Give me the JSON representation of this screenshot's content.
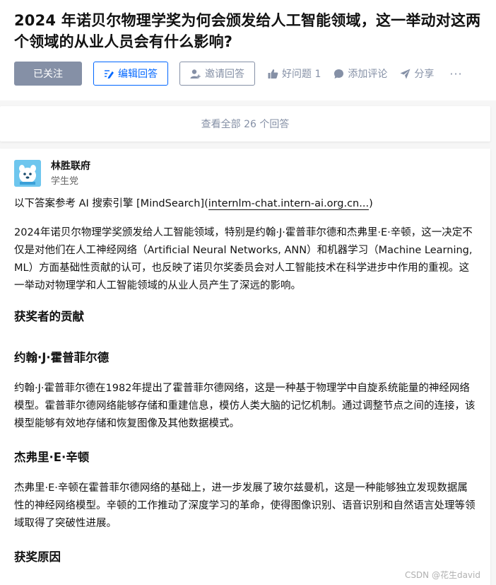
{
  "question": {
    "title": "2024 年诺贝尔物理学奖为何会颁发给人工智能领域，这一举动对这两个领域的从业人员会有什么影响?"
  },
  "actions": {
    "follow_label": "已关注",
    "edit_label": "编辑回答",
    "invite_label": "邀请回答",
    "good_question_label": "好问题 1",
    "comment_label": "添加评论",
    "share_label": "分享",
    "more_label": "···"
  },
  "view_all": {
    "label": "查看全部 26 个回答"
  },
  "answer": {
    "author_name": "林胜联府",
    "author_badge": "学生党",
    "source_prefix": "以下答案参考 AI 搜索引擎 [MindSearch](",
    "source_link": "internlm-chat.intern-ai.org.cn...",
    "source_suffix": ")",
    "intro": "2024年诺贝尔物理学奖颁发给人工智能领域，特别是约翰·J·霍普菲尔德和杰弗里·E·辛顿，这一决定不仅是对他们在人工神经网络（Artificial Neural Networks, ANN）和机器学习（Machine Learning, ML）方面基础性贡献的认可，也反映了诺贝尔奖委员会对人工智能技术在科学进步中作用的重视。这一举动对物理学和人工智能领域的从业人员产生了深远的影响。",
    "section1_heading": "获奖者的贡献",
    "hopfield_heading": "约翰·J·霍普菲尔德",
    "hopfield_text": "约翰·J·霍普菲尔德在1982年提出了霍普菲尔德网络，这是一种基于物理学中自旋系统能量的神经网络模型。霍普菲尔德网络能够存储和重建信息，模仿人类大脑的记忆机制。通过调整节点之间的连接，该模型能够有效地存储和恢复图像及其他数据模式。",
    "hinton_heading": "杰弗里·E·辛顿",
    "hinton_text": "杰弗里·E·辛顿在霍普菲尔德网络的基础上，进一步发展了玻尔兹曼机，这是一种能够独立发现数据属性的神经网络模型。辛顿的工作推动了深度学习的革命，使得图像识别、语音识别和自然语言处理等领域取得了突破性进展。",
    "section2_heading": "获奖原因"
  },
  "watermark": "CSDN @花生david",
  "colors": {
    "accent": "#0066ff",
    "muted": "#8590a6",
    "follow_bg": "#8590a6",
    "avatar_bg": "#6ec6ee"
  },
  "icons": {
    "edit": "edit-icon",
    "invite": "add-person-icon",
    "like": "thumbs-up-icon",
    "comment": "comment-bubble-icon",
    "share": "paper-plane-icon",
    "more": "more-dots-icon"
  }
}
